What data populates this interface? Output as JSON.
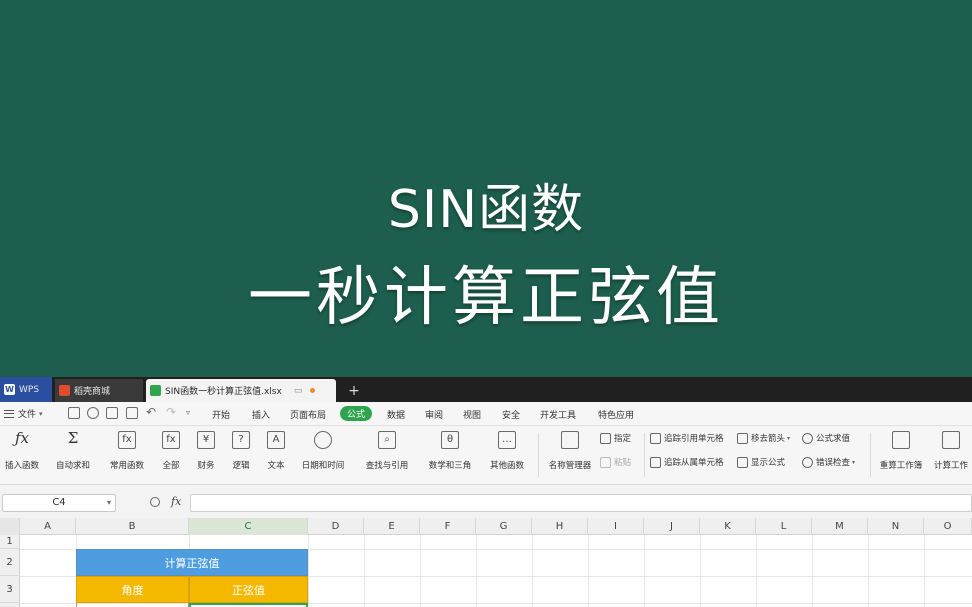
{
  "banner": {
    "line1": "SIN函数",
    "line2": "一秒计算正弦值"
  },
  "tabs": {
    "wps": "WPS",
    "store": "稻壳商城",
    "file": "SIN函数一秒计算正弦值.xlsx",
    "plus": "+"
  },
  "menu": {
    "file": "文件",
    "items": [
      "开始",
      "插入",
      "页面布局",
      "公式",
      "数据",
      "审阅",
      "视图",
      "安全",
      "开发工具",
      "特色应用"
    ],
    "active": "公式"
  },
  "ribbon": {
    "insert_function": "插入函数",
    "autosum": "自动求和",
    "common_functions": "常用函数",
    "all": "全部",
    "financial": "财务",
    "logical": "逻辑",
    "text": "文本",
    "datetime": "日期和时间",
    "lookup": "查找与引用",
    "math_trig": "数学和三角",
    "other": "其他函数",
    "name_manager": "名称管理器",
    "paste": "指定",
    "paste_dim": "粘贴",
    "trace_precedents": "追踪引用单元格",
    "trace_dependents": "追踪从属单元格",
    "remove_arrows": "移去箭头",
    "show_formulas": "显示公式",
    "evaluate": "公式求值",
    "error_check": "错误检查",
    "recalc_book": "重算工作簿",
    "calc_options": "计算工作"
  },
  "formula_bar": {
    "name_box": "C4",
    "fx": "fx",
    "content": ""
  },
  "grid": {
    "columns": [
      "A",
      "B",
      "C",
      "D",
      "E",
      "F",
      "G",
      "H",
      "I",
      "J",
      "K",
      "L",
      "M",
      "N",
      "O"
    ],
    "selected_column": "C",
    "rows": [
      "1",
      "2",
      "3"
    ]
  },
  "table": {
    "title": "计算正弦值",
    "header_angle": "角度",
    "header_sine": "正弦值"
  },
  "colors": {
    "banner_bg": "#1d5e4e",
    "accent_green": "#2fa44f",
    "table_title_blue": "#4e9de0",
    "table_header_yellow": "#f5b800"
  }
}
